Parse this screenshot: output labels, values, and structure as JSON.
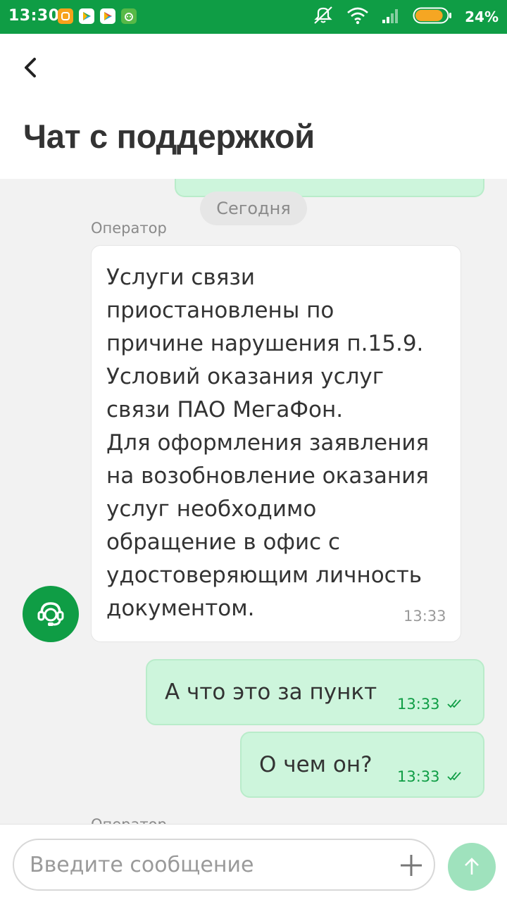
{
  "status_bar": {
    "time": "13:30",
    "battery_percent": "24%",
    "battery_level": 0.24,
    "app_icons": [
      "orange-app-icon",
      "play-store-icon",
      "play-store-icon",
      "android-icon"
    ],
    "system_icons": [
      "mute-icon",
      "wifi-icon",
      "signal-icon",
      "battery-icon"
    ]
  },
  "header": {
    "back_icon": "chevron-left-icon",
    "title": "Чат с поддержкой"
  },
  "chat": {
    "date_divider": "Сегодня",
    "operator_message": {
      "sender": "Оператор",
      "text": "Услуги связи\nприостановлены по\nпричине нарушения п.15.9.\nУсловий оказания услуг\nсвязи ПАО МегаФон.\nДля оформления заявления\nна возобновление оказания\nуслуг необходимо\nобращение в офис с\nудостоверяющим личность\nдокументом.",
      "time": "13:33",
      "avatar_icon": "support-agent-icon"
    },
    "outgoing_messages": [
      {
        "text": "А что это за пункт",
        "time": "13:33",
        "status_icon": "double-check-icon"
      },
      {
        "text": "О чем он?",
        "time": "13:33",
        "status_icon": "double-check-icon"
      }
    ],
    "next_sender_partial": "Оператор"
  },
  "input": {
    "placeholder": "Введите сообщение",
    "attach_icon": "plus-icon",
    "send_icon": "arrow-up-icon"
  },
  "colors": {
    "brand_green": "#0f9d45",
    "outgoing_bubble": "#cdf5dc",
    "send_button": "#9fe2bd"
  }
}
